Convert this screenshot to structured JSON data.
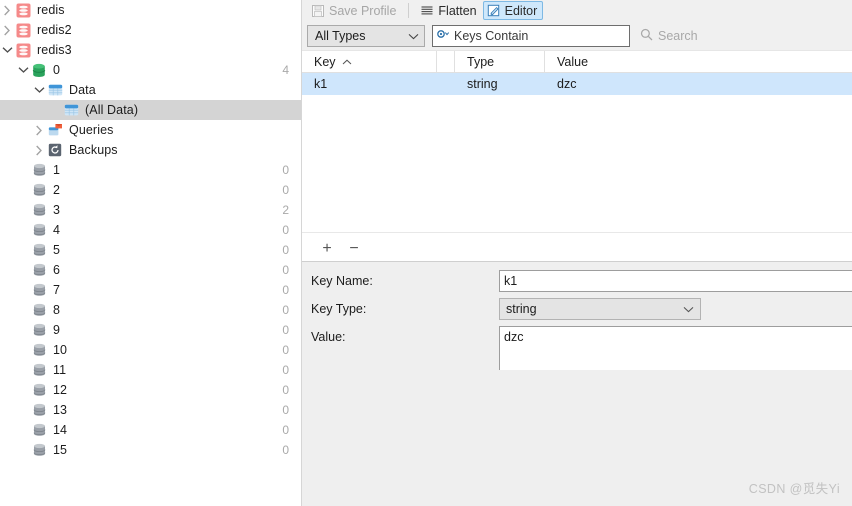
{
  "colors": {
    "redis_icon": "#f08080",
    "db_green": "#26a65b",
    "data_blue": "#4a9fe0",
    "selection_tree": "#d4d4d4",
    "selection_table": "#cfe6fc",
    "toolbar_bg": "#f0f0f0",
    "editor_bg": "#efefef",
    "accent_active": "#cfe8fb",
    "watermark": "#c2c2c2"
  },
  "tree": {
    "items": [
      {
        "label": "redis",
        "icon": "redis-server-icon",
        "indent": 0,
        "twisty": "collapsed",
        "count": "",
        "selected": false
      },
      {
        "label": "redis2",
        "icon": "redis-server-icon",
        "indent": 0,
        "twisty": "collapsed",
        "count": "",
        "selected": false
      },
      {
        "label": "redis3",
        "icon": "redis-server-icon",
        "indent": 0,
        "twisty": "expanded",
        "count": "",
        "selected": false
      },
      {
        "label": "0",
        "icon": "database-icon",
        "indent": 1,
        "twisty": "expanded",
        "count": "4",
        "selected": false
      },
      {
        "label": "Data",
        "icon": "data-folder-icon",
        "indent": 2,
        "twisty": "expanded",
        "count": "",
        "selected": false
      },
      {
        "label": "(All Data)",
        "icon": "data-folder-icon",
        "indent": 3,
        "twisty": "none",
        "count": "",
        "selected": true
      },
      {
        "label": "Queries",
        "icon": "queries-icon",
        "indent": 2,
        "twisty": "collapsed",
        "count": "",
        "selected": false
      },
      {
        "label": "Backups",
        "icon": "backups-icon",
        "indent": 2,
        "twisty": "collapsed",
        "count": "",
        "selected": false
      },
      {
        "label": "1",
        "icon": "database-grey-icon",
        "indent": 1,
        "twisty": "none",
        "count": "0",
        "selected": false
      },
      {
        "label": "2",
        "icon": "database-grey-icon",
        "indent": 1,
        "twisty": "none",
        "count": "0",
        "selected": false
      },
      {
        "label": "3",
        "icon": "database-grey-icon",
        "indent": 1,
        "twisty": "none",
        "count": "2",
        "selected": false
      },
      {
        "label": "4",
        "icon": "database-grey-icon",
        "indent": 1,
        "twisty": "none",
        "count": "0",
        "selected": false
      },
      {
        "label": "5",
        "icon": "database-grey-icon",
        "indent": 1,
        "twisty": "none",
        "count": "0",
        "selected": false
      },
      {
        "label": "6",
        "icon": "database-grey-icon",
        "indent": 1,
        "twisty": "none",
        "count": "0",
        "selected": false
      },
      {
        "label": "7",
        "icon": "database-grey-icon",
        "indent": 1,
        "twisty": "none",
        "count": "0",
        "selected": false
      },
      {
        "label": "8",
        "icon": "database-grey-icon",
        "indent": 1,
        "twisty": "none",
        "count": "0",
        "selected": false
      },
      {
        "label": "9",
        "icon": "database-grey-icon",
        "indent": 1,
        "twisty": "none",
        "count": "0",
        "selected": false
      },
      {
        "label": "10",
        "icon": "database-grey-icon",
        "indent": 1,
        "twisty": "none",
        "count": "0",
        "selected": false
      },
      {
        "label": "11",
        "icon": "database-grey-icon",
        "indent": 1,
        "twisty": "none",
        "count": "0",
        "selected": false
      },
      {
        "label": "12",
        "icon": "database-grey-icon",
        "indent": 1,
        "twisty": "none",
        "count": "0",
        "selected": false
      },
      {
        "label": "13",
        "icon": "database-grey-icon",
        "indent": 1,
        "twisty": "none",
        "count": "0",
        "selected": false
      },
      {
        "label": "14",
        "icon": "database-grey-icon",
        "indent": 1,
        "twisty": "none",
        "count": "0",
        "selected": false
      },
      {
        "label": "15",
        "icon": "database-grey-icon",
        "indent": 1,
        "twisty": "none",
        "count": "0",
        "selected": false
      }
    ]
  },
  "toolbar": {
    "save_profile_label": "Save Profile",
    "save_profile_enabled": false,
    "flatten_label": "Flatten",
    "editor_label": "Editor",
    "editor_active": true
  },
  "filterbar": {
    "type_filter_value": "All Types",
    "keys_contain_value": "",
    "keys_contain_placeholder": "Keys Contain",
    "search_label": "Search"
  },
  "table": {
    "columns": [
      "Key",
      "",
      "Type",
      "Value"
    ],
    "sort_column": "Key",
    "sort_direction": "ascending",
    "rows": [
      {
        "key": "k1",
        "type": "string",
        "value": "dzc",
        "selected": true
      }
    ]
  },
  "editor": {
    "add_label": "+",
    "remove_label": "−",
    "fields": {
      "key_name_label": "Key Name:",
      "key_name_value": "k1",
      "key_type_label": "Key Type:",
      "key_type_value": "string",
      "value_label": "Value:",
      "value_value": "dzc"
    }
  },
  "watermark": {
    "text": "CSDN @觅失Yi"
  }
}
